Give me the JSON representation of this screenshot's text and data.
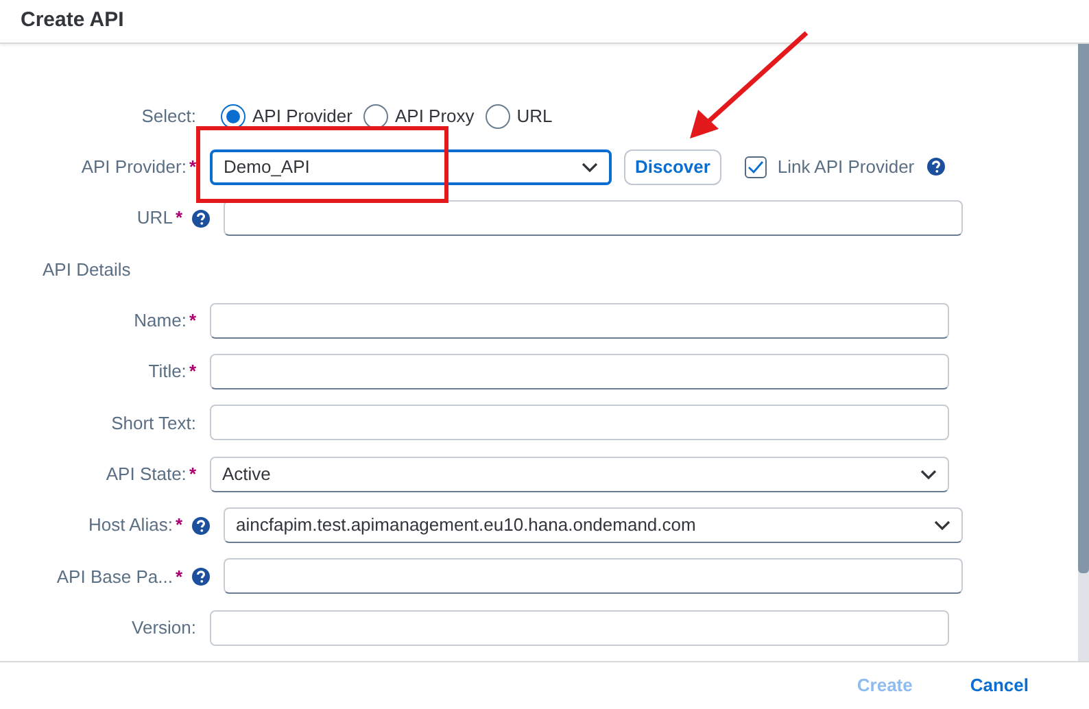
{
  "dialog": {
    "title": "Create API"
  },
  "rows": [
    {
      "kind": "radio",
      "label": "Select:",
      "options": [
        {
          "label": "API Provider",
          "selected": true
        },
        {
          "label": "API Proxy",
          "selected": false
        },
        {
          "label": "URL",
          "selected": false
        }
      ]
    },
    {
      "kind": "provider",
      "label": "API Provider:",
      "asterisk": "*",
      "value": "Demo_API",
      "focused": true,
      "button": "Discover",
      "checkbox": {
        "label": "Link API Provider",
        "checked": true
      }
    },
    {
      "kind": "input",
      "label": "URL",
      "asterisk": "*",
      "help": true
    },
    {
      "kind": "section",
      "label": "API Details"
    },
    {
      "kind": "input",
      "label": "Name:",
      "asterisk": "*"
    },
    {
      "kind": "input",
      "label": "Title:",
      "asterisk": "*"
    },
    {
      "kind": "input",
      "label": "Short Text:"
    },
    {
      "kind": "select",
      "label": "API State:",
      "asterisk": "*",
      "value": "Active"
    },
    {
      "kind": "select",
      "label": "Host Alias:",
      "asterisk": "*",
      "help": true,
      "value": "aincfapim.test.apimanagement.eu10.hana.ondemand.com"
    },
    {
      "kind": "input",
      "label": "API Base Pa...",
      "asterisk": "*",
      "help": true
    },
    {
      "kind": "input",
      "label": "Version:"
    },
    {
      "kind": "partial"
    }
  ],
  "footer": {
    "buttons": [
      {
        "label": "Create",
        "disabled": true
      },
      {
        "label": "Cancel",
        "disabled": false
      }
    ]
  },
  "annotations": {
    "highlight_box": {
      "color": "#e3191c"
    },
    "arrow": {
      "color": "#e3191c"
    }
  }
}
